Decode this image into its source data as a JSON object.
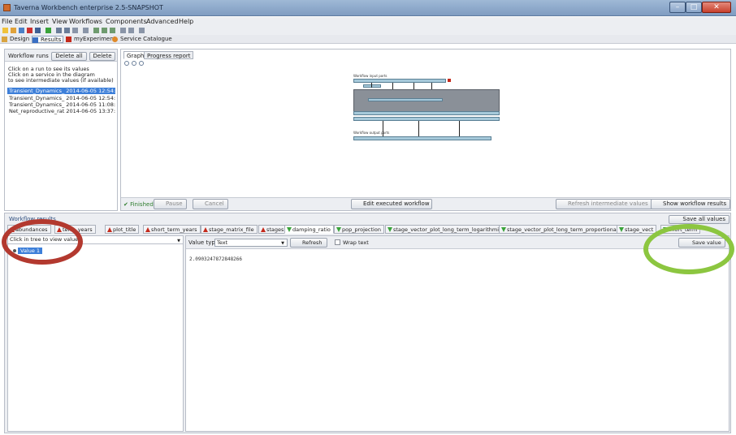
{
  "window": {
    "title": "Taverna Workbench enterprise 2.5-SNAPSHOT"
  },
  "menu": [
    "File",
    "Edit",
    "Insert",
    "View",
    "Workflows",
    "Components",
    "Advanced",
    "Help"
  ],
  "perspectives": [
    {
      "label": "Design",
      "icon": "design-icon"
    },
    {
      "label": "Results",
      "icon": "results-icon",
      "active": true
    },
    {
      "label": "myExperiment",
      "icon": "myexperiment-icon"
    },
    {
      "label": "Service Catalogue",
      "icon": "service-catalogue-icon"
    }
  ],
  "runs": {
    "header_label": "Workflow runs",
    "delete_all": "Delete all",
    "delete": "Delete",
    "help": [
      "Click on a run to see its values",
      "Click on a service in the diagram",
      "to see intermediate values (if available)"
    ],
    "items": [
      "Transient_Dynamics_ 2014-06-05 12:54:43",
      "Transient_Dynamics_ 2014-06-05 12:54:27",
      "Transient_Dynamics_ 2014-06-05 11:08:44",
      "Net_reproductive_rat 2014-06-05 13:37:43"
    ]
  },
  "graph": {
    "tabs": [
      "Graph",
      "Progress report"
    ],
    "labels": [
      "Workflow input ports",
      "Workflow output ports"
    ]
  },
  "status": {
    "finished": "Finished",
    "pause": "Pause",
    "cancel": "Cancel",
    "edit": "Edit executed workflow",
    "refresh": "Refresh intermediate values",
    "show": "Show workflow results"
  },
  "results": {
    "title": "Workflow results",
    "see_all": "Save all values",
    "tabs": [
      {
        "label": "abundances",
        "dir": "up"
      },
      {
        "label": "term_years",
        "dir": "up"
      },
      {
        "label": "plot_title",
        "dir": "up"
      },
      {
        "label": "short_term_years",
        "dir": "up"
      },
      {
        "label": "stage_matrix_file",
        "dir": "up"
      },
      {
        "label": "stages",
        "dir": "up"
      },
      {
        "label": "damping_ratio",
        "dir": "down",
        "active": true
      },
      {
        "label": "pop_projection",
        "dir": "down"
      },
      {
        "label": "stage_vector_plot_long_term_logarithmic",
        "dir": "down"
      },
      {
        "label": "stage_vector_plot_long_term_proportional",
        "dir": "down"
      },
      {
        "label": "stage_vect",
        "dir": "down"
      },
      {
        "label": "short_term",
        "dir": "down"
      }
    ],
    "tree_prompt": "Click in tree to view values",
    "tree_node": "Value 1",
    "value_type_label": "Value type",
    "value_type": "Text",
    "refresh": "Refresh",
    "wrap_text": "Wrap text",
    "save_value": "Save value",
    "value": "2.0903247872848266"
  },
  "colors": {
    "highlight_red": "#b3392f",
    "highlight_green": "#8cc640",
    "selection": "#3d7fd9"
  }
}
